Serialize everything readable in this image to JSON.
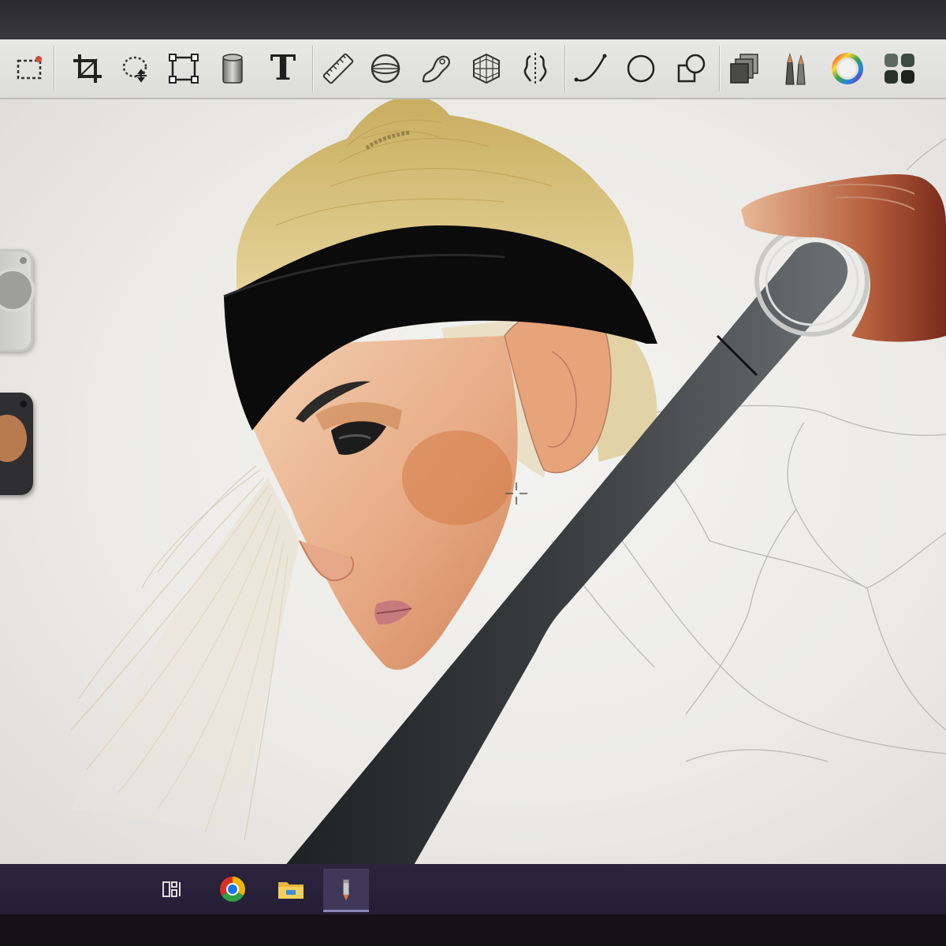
{
  "toolbar": {
    "tools": [
      {
        "name": "selection-tool",
        "icon": "selection-marquee-icon"
      },
      {
        "name": "crop-tool",
        "icon": "crop-icon"
      },
      {
        "name": "lasso-transform-tool",
        "icon": "lasso-move-icon"
      },
      {
        "name": "transform-tool",
        "icon": "transform-box-icon"
      },
      {
        "name": "fill-tool",
        "icon": "paint-bucket-icon"
      },
      {
        "name": "text-tool",
        "icon": "text-icon",
        "glyph": "T"
      },
      {
        "name": "ruler-tool",
        "icon": "ruler-icon"
      },
      {
        "name": "ellipse-guide-tool",
        "icon": "ellipse-guide-icon"
      },
      {
        "name": "french-curve-tool",
        "icon": "french-curve-icon"
      },
      {
        "name": "perspective-tool",
        "icon": "perspective-grid-icon"
      },
      {
        "name": "symmetry-tool",
        "icon": "symmetry-icon"
      },
      {
        "name": "stroke-tool",
        "icon": "curve-stroke-icon"
      },
      {
        "name": "shape-tool",
        "icon": "circle-shape-icon"
      },
      {
        "name": "shape-combine-tool",
        "icon": "shape-combine-icon"
      },
      {
        "name": "layers-tool",
        "icon": "layers-icon"
      },
      {
        "name": "brushes-tool",
        "icon": "brushes-icon"
      },
      {
        "name": "color-wheel-tool",
        "icon": "color-wheel-icon"
      },
      {
        "name": "ui-panels-tool",
        "icon": "grid-panels-icon"
      }
    ]
  },
  "canvas": {
    "brush_color": "#b87a4f",
    "cursor": "crosshair"
  },
  "taskbar": {
    "items": [
      {
        "name": "task-view",
        "icon": "task-view-icon"
      },
      {
        "name": "chrome",
        "icon": "chrome-icon"
      },
      {
        "name": "file-explorer",
        "icon": "folder-icon"
      },
      {
        "name": "sketchbook",
        "icon": "pencil-app-icon",
        "active": true
      }
    ]
  },
  "colors": {
    "toolbar_bg": "#e0e0dd",
    "canvas_bg": "#efefec",
    "taskbar_bg": "#272139",
    "hair": "#d6c07a",
    "headband": "#0b0b0c",
    "skin": "#e7b28a",
    "sword": "#2b2e30"
  }
}
